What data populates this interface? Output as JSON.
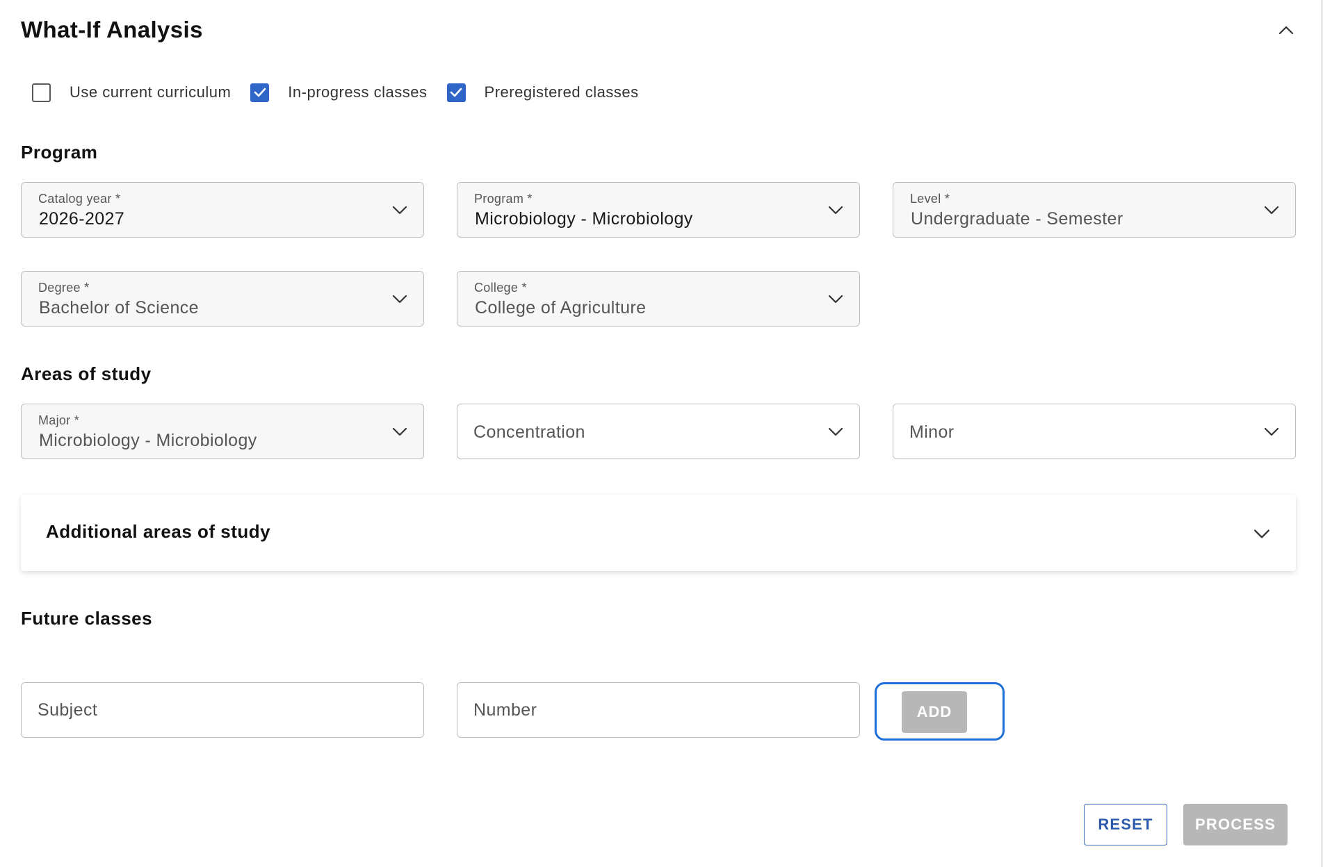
{
  "header": {
    "title": "What-If Analysis",
    "collapse_icon": "chevron-up-icon"
  },
  "options": {
    "use_current_curriculum": {
      "label": "Use current curriculum",
      "checked": false
    },
    "in_progress_classes": {
      "label": "In-progress classes",
      "checked": true
    },
    "preregistered_classes": {
      "label": "Preregistered classes",
      "checked": true
    }
  },
  "program_section": {
    "heading": "Program",
    "catalog_year": {
      "label": "Catalog year *",
      "value": "2026-2027"
    },
    "program": {
      "label": "Program *",
      "value": "Microbiology - Microbiology"
    },
    "level": {
      "label": "Level *",
      "value": "Undergraduate - Semester"
    },
    "degree": {
      "label": "Degree *",
      "value": "Bachelor of Science"
    },
    "college": {
      "label": "College *",
      "value": "College of Agriculture"
    }
  },
  "areas_section": {
    "heading": "Areas of study",
    "major": {
      "label": "Major *",
      "value": "Microbiology - Microbiology"
    },
    "concentration": {
      "placeholder": "Concentration"
    },
    "minor": {
      "placeholder": "Minor"
    }
  },
  "additional_areas": {
    "title": "Additional areas of study",
    "expand_icon": "chevron-down-icon"
  },
  "future_classes": {
    "heading": "Future classes",
    "subject": {
      "placeholder": "Subject",
      "value": ""
    },
    "number": {
      "placeholder": "Number",
      "value": ""
    },
    "add_label": "ADD"
  },
  "actions": {
    "reset_label": "RESET",
    "process_label": "PROCESS"
  },
  "colors": {
    "accent": "#2f64c9",
    "focus_ring": "#1e6fd9",
    "disabled_button": "#b7b7b7",
    "reset_text": "#2c5aad"
  }
}
